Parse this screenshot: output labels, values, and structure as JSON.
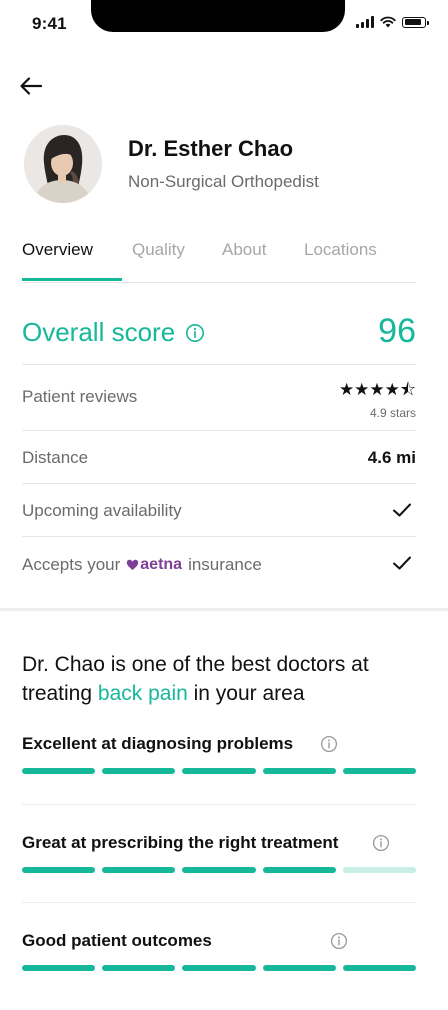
{
  "status": {
    "time": "9:41"
  },
  "doctor": {
    "name": "Dr. Esther Chao",
    "specialty": "Non-Surgical Orthopedist"
  },
  "tabs": [
    {
      "label": "Overview",
      "active": true
    },
    {
      "label": "Quality",
      "active": false
    },
    {
      "label": "About",
      "active": false
    },
    {
      "label": "Locations",
      "active": false
    }
  ],
  "score": {
    "label": "Overall score",
    "value": "96"
  },
  "rows": {
    "reviews": {
      "label": "Patient reviews",
      "stars": "★★★★⯪",
      "rating": 4.9,
      "caption": "4.9 stars"
    },
    "distance": {
      "label": "Distance",
      "value": "4.6 mi"
    },
    "availability": {
      "label": "Upcoming availability",
      "checked": true
    },
    "insurance": {
      "label_before": "Accepts your",
      "brand": "aetna",
      "label_after": "insurance",
      "checked": true
    }
  },
  "best": {
    "prefix": "Dr. Chao is one of the best doctors at treating ",
    "highlight": "back pain",
    "suffix": " in your area"
  },
  "metrics": [
    {
      "label": "Excellent at diagnosing problems",
      "filled": 5,
      "total": 5
    },
    {
      "label": "Great at prescribing the right treatment",
      "filled": 4,
      "total": 5
    },
    {
      "label": "Good patient outcomes",
      "filled": 5,
      "total": 5
    }
  ],
  "colors": {
    "accent": "#16b89a",
    "accent_light": "#c9eee6",
    "aetna": "#7d3f98",
    "muted": "#6b6b6b"
  },
  "icons": [
    "back-arrow-icon",
    "info-icon",
    "checkmark-icon",
    "star-icon",
    "heart-icon",
    "signal-icon",
    "wifi-icon",
    "battery-icon"
  ]
}
